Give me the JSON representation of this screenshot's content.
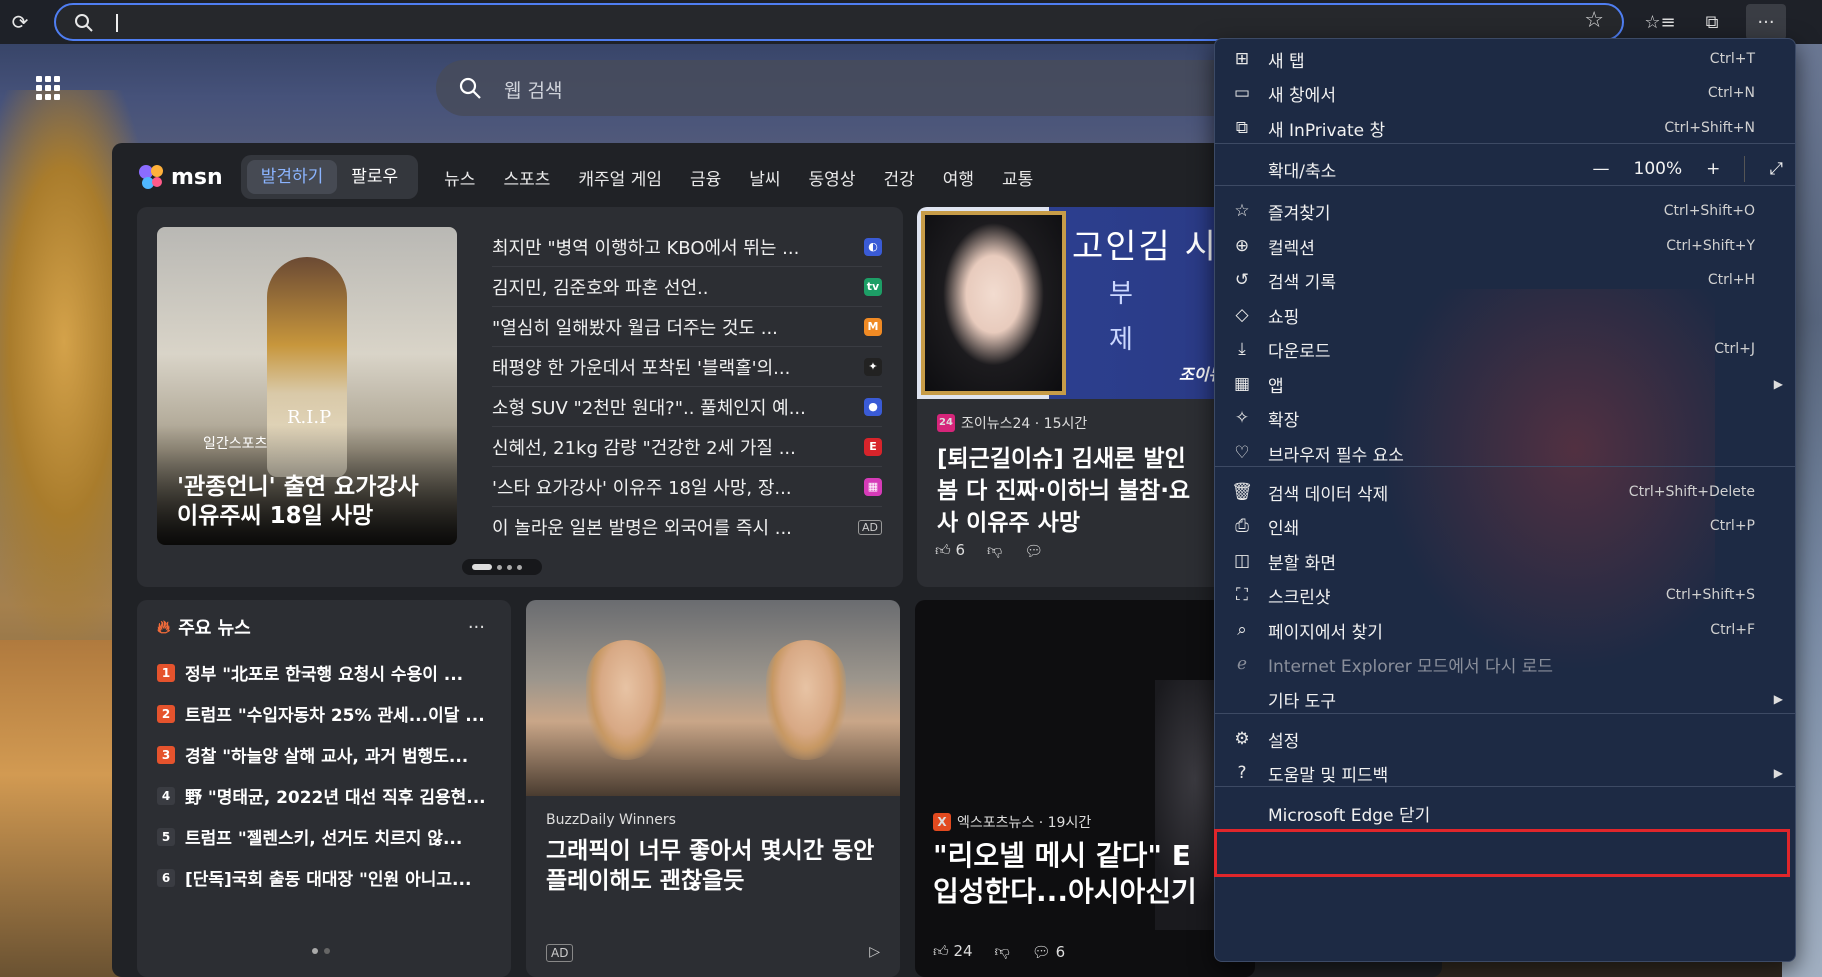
{
  "browser": {
    "address_placeholder": "",
    "toolbar_icons": [
      "refresh-icon",
      "search-icon",
      "favorite-star-icon",
      "favorites-icon",
      "collections-icon",
      "more-icon"
    ]
  },
  "msn": {
    "search_placeholder": "웹 검색",
    "logo_text": "msn",
    "pills": [
      "발견하기",
      "팔로우"
    ],
    "nav": [
      "뉴스",
      "스포츠",
      "캐주얼 게임",
      "금융",
      "날씨",
      "동영상",
      "건강",
      "여행",
      "교통"
    ]
  },
  "hero": {
    "source": "일간스포츠",
    "rip_text": "R.I.P",
    "caption": "'관종언니' 출연 요가강사 이유주씨 18일 사망",
    "headlines": [
      {
        "text": "최지만 \"병역 이행하고 KBO에서 뛰는 ...",
        "icon_color": "#3a5bd6",
        "icon_text": "◐"
      },
      {
        "text": "김지민, 김준호와 파혼 선언..",
        "icon_color": "#1d9e66",
        "icon_text": "tv"
      },
      {
        "text": "\"열심히 일해봤자 월급 더주는 것도 ...",
        "icon_color": "#f08a24",
        "icon_text": "M"
      },
      {
        "text": "태평양 한 가운데서 포착된 '블랙홀'의...",
        "icon_color": "#222222",
        "icon_text": "✦"
      },
      {
        "text": "소형 SUV \"2천만 원대?\".. 풀체인지 예...",
        "icon_color": "#3a5bd6",
        "icon_text": "●"
      },
      {
        "text": "신혜선, 21kg 감량 \"건강한 2세 가질 ...",
        "icon_color": "#d8242b",
        "icon_text": "E"
      },
      {
        "text": "'스타 요가강사' 이유주 18일 사망, 장...",
        "icon_color": "#d63bb8",
        "icon_text": "▦"
      },
      {
        "text": "이 놀라운 일본 발명은 외국어를 즉시 ...",
        "ad": "AD"
      }
    ]
  },
  "card2": {
    "image_title": "고인김 시",
    "image_sub": [
      "부",
      "제"
    ],
    "image_brand": "조이뉴",
    "source": "조이뉴스24 · 15시간",
    "title_lines": [
      "[퇴근길이슈] 김새론 발인",
      "봄 다 진짜·이하늬 불참·요",
      "사 이유주 사망"
    ],
    "likes": "6"
  },
  "top_news": {
    "heading": "주요 뉴스",
    "more": "...",
    "items": [
      {
        "n": "1",
        "text": "정부 \"北포로 한국행 요청시 수용이 ...",
        "color": "#e5532d"
      },
      {
        "n": "2",
        "text": "트럼프 \"수입자동차 25% 관세...이달 ...",
        "color": "#e5532d"
      },
      {
        "n": "3",
        "text": "경찰 \"하늘양 살해 교사, 과거 범행도...",
        "color": "#e5532d"
      },
      {
        "n": "4",
        "text": "野 \"명태균, 2022년 대선 직후 김용현...",
        "color": "#3a3c42"
      },
      {
        "n": "5",
        "text": "트럼프 \"젤렌스키, 선거도 치르지 않...",
        "color": "#3a3c42"
      },
      {
        "n": "6",
        "text": "[단독]국회 출동 대대장 \"인원 아니고...",
        "color": "#3a3c42"
      }
    ]
  },
  "ad_card": {
    "source": "BuzzDaily Winners",
    "title": "그래픽이 너무 좋아서 몇시간 동안 플레이해도 괜찮을듯",
    "badge": "AD"
  },
  "card5": {
    "source": "엑스포츠뉴스 · 19시간",
    "title_lines": [
      "\"리오넬 메시 같다\" E",
      "입성한다...아시아신기"
    ],
    "likes": "24",
    "comments": "6"
  },
  "menu": {
    "items": [
      {
        "label": "새 탭",
        "shortcut": "Ctrl+T",
        "icon": "new-tab-icon",
        "glyph": "⊞"
      },
      {
        "label": "새 창에서",
        "shortcut": "Ctrl+N",
        "icon": "new-window-icon",
        "glyph": "▭"
      },
      {
        "label": "새 InPrivate 창",
        "shortcut": "Ctrl+Shift+N",
        "icon": "inprivate-icon",
        "glyph": "⧉"
      },
      {
        "label": "확대/축소",
        "zoom": "100%",
        "icon": "zoom-icon",
        "glyph": ""
      },
      {
        "label": "즐겨찾기",
        "shortcut": "Ctrl+Shift+O",
        "icon": "favorites-icon",
        "glyph": "☆"
      },
      {
        "label": "컬렉션",
        "shortcut": "Ctrl+Shift+Y",
        "icon": "collections-icon",
        "glyph": "⊕"
      },
      {
        "label": "검색 기록",
        "shortcut": "Ctrl+H",
        "icon": "history-icon",
        "glyph": "↺"
      },
      {
        "label": "쇼핑",
        "shortcut": "",
        "icon": "shopping-icon",
        "glyph": "◇"
      },
      {
        "label": "다운로드",
        "shortcut": "Ctrl+J",
        "icon": "download-icon",
        "glyph": "⤓"
      },
      {
        "label": "앱",
        "shortcut": "",
        "icon": "apps-icon",
        "glyph": "▦",
        "arrow": true
      },
      {
        "label": "확장",
        "shortcut": "",
        "icon": "extensions-icon",
        "glyph": "✧"
      },
      {
        "label": "브라우저 필수 요소",
        "shortcut": "",
        "icon": "essentials-icon",
        "glyph": "♡"
      },
      {
        "label": "검색 데이터 삭제",
        "shortcut": "Ctrl+Shift+Delete",
        "icon": "trash-icon",
        "glyph": "🗑"
      },
      {
        "label": "인쇄",
        "shortcut": "Ctrl+P",
        "icon": "print-icon",
        "glyph": "⎙"
      },
      {
        "label": "분할 화면",
        "shortcut": "",
        "icon": "split-screen-icon",
        "glyph": "◫"
      },
      {
        "label": "스크린샷",
        "shortcut": "Ctrl+Shift+S",
        "icon": "screenshot-icon",
        "glyph": "⛶"
      },
      {
        "label": "페이지에서 찾기",
        "shortcut": "Ctrl+F",
        "icon": "find-icon",
        "glyph": "⌕"
      },
      {
        "label": "Internet Explorer 모드에서 다시 로드",
        "shortcut": "",
        "icon": "ie-mode-icon",
        "glyph": "ℯ",
        "disabled": true
      },
      {
        "label": "기타 도구",
        "shortcut": "",
        "icon": "",
        "glyph": "",
        "arrow": true
      },
      {
        "label": "설정",
        "shortcut": "",
        "icon": "settings-icon",
        "glyph": "⚙"
      },
      {
        "label": "도움말 및 피드백",
        "shortcut": "",
        "icon": "help-icon",
        "glyph": "?",
        "arrow": true
      },
      {
        "label": "Microsoft Edge 닫기",
        "shortcut": "",
        "icon": "",
        "glyph": ""
      }
    ],
    "highlight_color": "#e0262b"
  }
}
